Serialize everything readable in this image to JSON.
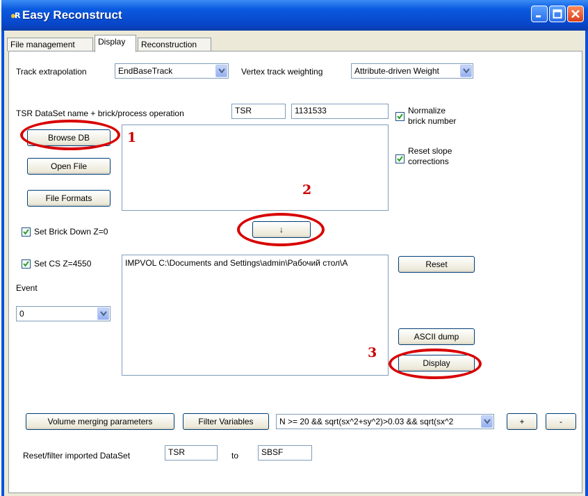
{
  "window": {
    "title": "Easy Reconstruct",
    "app_icon": "app-icon"
  },
  "titlebar": {
    "minimize_icon": "minimize-icon",
    "maximize_icon": "maximize-icon",
    "close_icon": "close-icon"
  },
  "tabs": [
    {
      "label": "File management"
    },
    {
      "label": "Display"
    },
    {
      "label": "Reconstruction"
    }
  ],
  "active_tab": "Display",
  "track_extrapolation": {
    "label": "Track extrapolation",
    "value": "EndBaseTrack"
  },
  "vertex_weighting": {
    "label": "Vertex track weighting",
    "value": "Attribute-driven Weight"
  },
  "tsr": {
    "label": "TSR DataSet name + brick/process operation",
    "name_value": "TSR",
    "brick_value": "1131533"
  },
  "options": {
    "normalize_line1": "Normalize",
    "normalize_line2": "brick number",
    "reset_slope_line1": "Reset  slope",
    "reset_slope_line2": "corrections"
  },
  "buttons": {
    "browse_db": "Browse DB",
    "open_file": "Open File",
    "file_formats": "File Formats",
    "arrow_down": "↓",
    "reset": "Reset",
    "ascii_dump": "ASCII dump",
    "display": "Display",
    "volume_merging": "Volume merging parameters",
    "filter_variables": "Filter Variables",
    "plus": "+",
    "minus": "-"
  },
  "checkboxes": {
    "set_brick_down": "Set Brick Down Z=0",
    "set_cs": "Set CS Z=4550"
  },
  "event": {
    "label": "Event",
    "value": "0"
  },
  "file_list": {
    "line1": "IMPVOL C:\\Documents and Settings\\admin\\Рабочий стол\\A"
  },
  "filter_expression": {
    "value": "N >= 20 && sqrt(sx^2+sy^2)>0.03 && sqrt(sx^2"
  },
  "reset_filter": {
    "label": "Reset/filter imported DataSet",
    "from_value": "TSR",
    "to_label": "to",
    "to_value": "SBSF"
  },
  "annotations": {
    "marker_1": "1",
    "marker_2": "2",
    "marker_3": "3",
    "annotation_color": "#d80000"
  }
}
